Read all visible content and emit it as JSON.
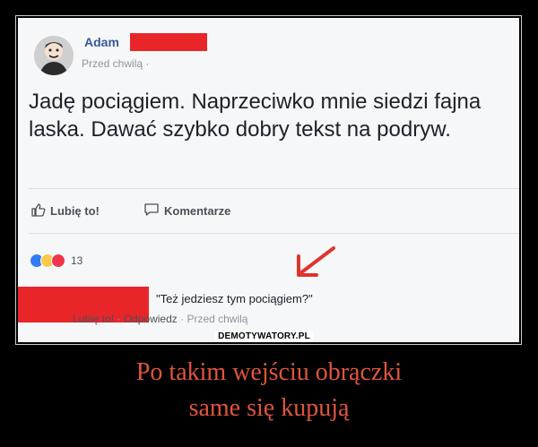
{
  "post": {
    "author": "Adam",
    "time": "Przed chwilą ·",
    "text": "Jadę pociągiem. Naprzeciwko mnie siedzi fajna laska. Dawać szybko dobry tekst na podryw.",
    "like_label": "Lubię to!",
    "comment_label": "Komentarze",
    "reaction_count": "13"
  },
  "comment": {
    "text": "\"Też jedziesz tym pociągiem?\"",
    "like": "Lubię to!",
    "sep1": " · ",
    "reply": "Odpowiedz",
    "sep2": " · ",
    "time": "Przed chwilą"
  },
  "watermark": "DEMOTYWATORY.PL",
  "caption": {
    "line1": "Po takim wejściu obrączki",
    "line2": "same się kupują"
  },
  "colors": {
    "redaction": "#e8262a",
    "caption": "#e0553c",
    "link": "#365899"
  }
}
